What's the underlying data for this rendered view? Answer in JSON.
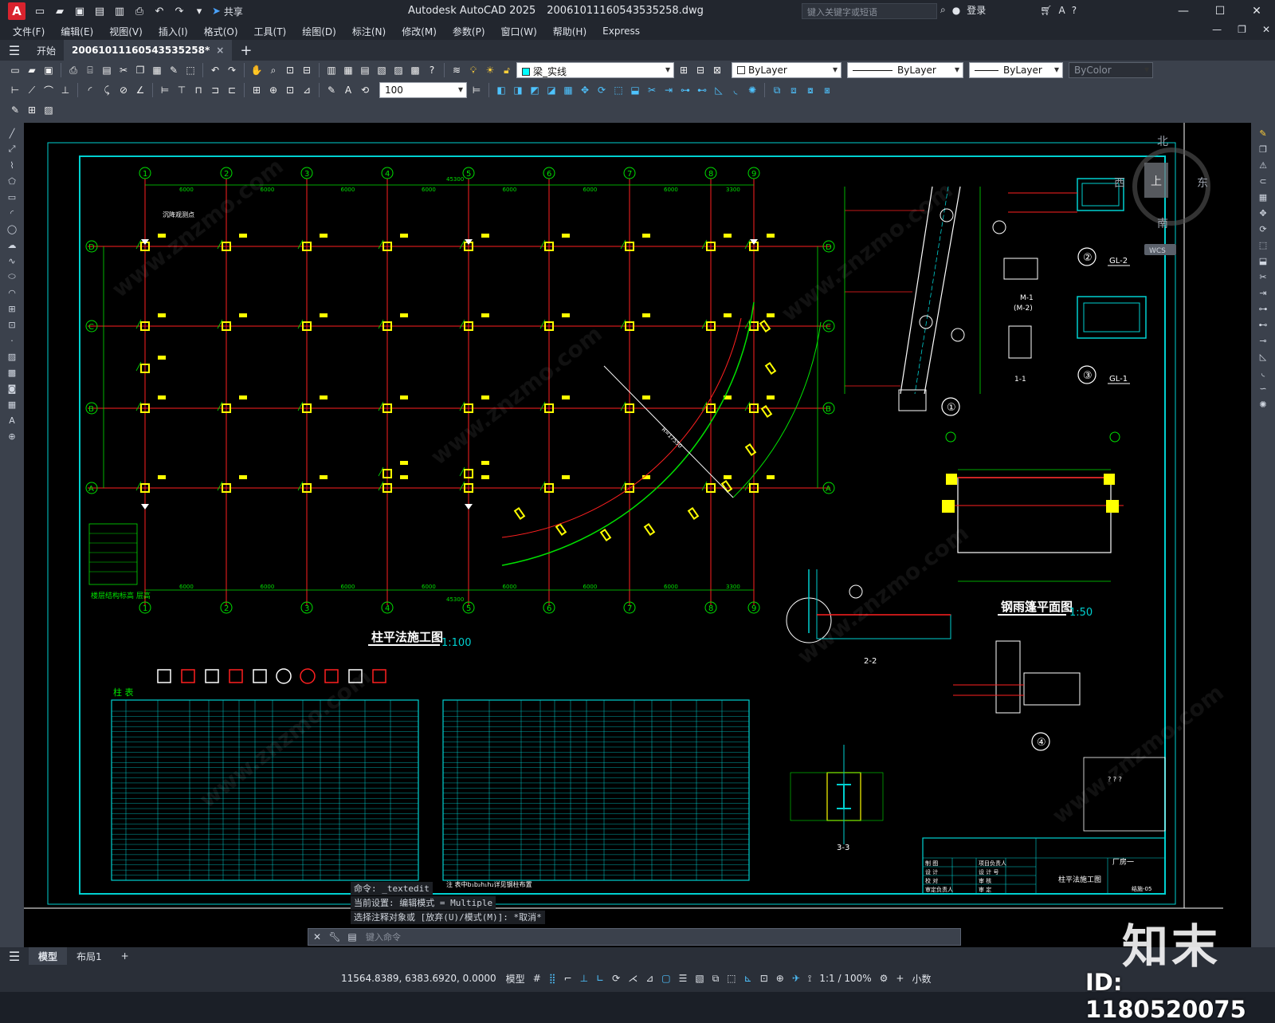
{
  "app": {
    "title": "Autodesk AutoCAD 2025",
    "filename": "20061011160543535258.dwg",
    "search_placeholder": "键入关键字或短语",
    "login": "登录",
    "share": "共享"
  },
  "menu": [
    "文件(F)",
    "编辑(E)",
    "视图(V)",
    "插入(I)",
    "格式(O)",
    "工具(T)",
    "绘图(D)",
    "标注(N)",
    "修改(M)",
    "参数(P)",
    "窗口(W)",
    "帮助(H)",
    "Express"
  ],
  "tabs": {
    "start": "开始",
    "file": "20061011160543535258*",
    "close": "×",
    "add": "+"
  },
  "toolbar": {
    "layer_name": "梁_实线",
    "color": "ByLayer",
    "linetype": "ByLayer",
    "lineweight": "ByLayer",
    "plotstyle": "ByColor",
    "scale_value": "100"
  },
  "drawing": {
    "plan_title": "柱平法施工图",
    "plan_scale": "1:100",
    "canopy_title": "钢雨篷平面图",
    "canopy_scale": "1:50",
    "section_22": "2-2",
    "section_33": "3-3",
    "section_11": "1-1",
    "gl2": "GL-2",
    "gl1": "GL-1",
    "m1": "M-1",
    "m2": "(M-2)",
    "note_settlement": "沉降观测点",
    "circled": [
      "①",
      "②",
      "③",
      "④"
    ],
    "axes_top": [
      "1",
      "2",
      "3",
      "4",
      "5",
      "6",
      "7",
      "8",
      "9"
    ],
    "axes_side": [
      "D",
      "C",
      "B",
      "A"
    ],
    "dim_top": [
      "6000",
      "6000",
      "6000",
      "6000",
      "6000",
      "6000",
      "6000",
      "3300"
    ],
    "dim_total": "45300",
    "column_table_title": "柱 表",
    "title_block_project": "厂房一",
    "title_block_drawing": "柱平法施工图",
    "title_block_rows": [
      "制 图",
      "设 计",
      "校 对",
      "审定负责人"
    ],
    "title_block_rows2": [
      "项目负责人",
      "设 计 号",
      "审 核",
      "审 定"
    ],
    "title_block_number": "结施-05",
    "stamp_text": "? ? ?",
    "compass": {
      "n": "北",
      "s": "南",
      "e": "东",
      "w": "西",
      "center": "上",
      "wcs": "WCS"
    },
    "floor_table_label": "楼层结构标高   层高",
    "table_note": "注  表中b₁b₂h₁h₂详见钢柱布置"
  },
  "command": {
    "line1": "命令: _textedit",
    "line2": "当前设置: 编辑模式 = Multiple",
    "line3": "选择注释对象或 [放弃(U)/模式(M)]: *取消*",
    "placeholder": "键入命令"
  },
  "layout_tabs": [
    "模型",
    "布局1"
  ],
  "status": {
    "coords": "11564.8389, 6383.6920, 0.0000",
    "space": "模型",
    "scale": "1:1 / 100%",
    "units": "小数"
  },
  "watermark": {
    "brand": "知末",
    "id": "ID: 1180520075",
    "site": "www.znzmo.com"
  },
  "colors": {
    "canvas": "#000000",
    "axis_red": "#ff2020",
    "dim_green": "#00e000",
    "frame_cyan": "#00d0d0",
    "column_yellow": "#ffff00",
    "ui_dark": "#3b414c"
  }
}
